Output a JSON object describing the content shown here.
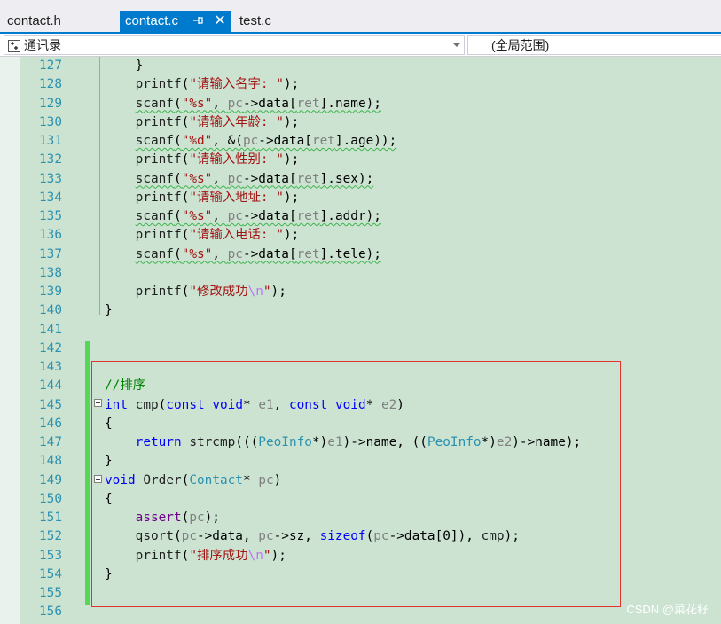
{
  "tabs": [
    {
      "label": "contact.h",
      "active": false
    },
    {
      "label": "contact.c",
      "active": true
    },
    {
      "label": "test.c",
      "active": false
    }
  ],
  "nav": {
    "scope_left": "通讯录",
    "scope_right": "(全局范围)"
  },
  "editor": {
    "lines": [
      {
        "n": "127",
        "tokens": [
          [
            "plain",
            "    }"
          ]
        ]
      },
      {
        "n": "128",
        "tokens": [
          [
            "plain",
            "    "
          ],
          [
            "fn",
            "printf"
          ],
          [
            "plain",
            "("
          ],
          [
            "str",
            "\"请输入名字: \""
          ],
          [
            "plain",
            ");"
          ]
        ]
      },
      {
        "n": "129",
        "squig": true,
        "tokens": [
          [
            "plain",
            "    "
          ],
          [
            "fn",
            "scanf"
          ],
          [
            "plain",
            "("
          ],
          [
            "str",
            "\"%s\""
          ],
          [
            "plain",
            ", "
          ],
          [
            "param",
            "pc"
          ],
          [
            "plain",
            "->data["
          ],
          [
            "param",
            "ret"
          ],
          [
            "plain",
            "].name);"
          ]
        ]
      },
      {
        "n": "130",
        "tokens": [
          [
            "plain",
            "    "
          ],
          [
            "fn",
            "printf"
          ],
          [
            "plain",
            "("
          ],
          [
            "str",
            "\"请输入年龄: \""
          ],
          [
            "plain",
            ");"
          ]
        ]
      },
      {
        "n": "131",
        "squig": true,
        "tokens": [
          [
            "plain",
            "    "
          ],
          [
            "fn",
            "scanf"
          ],
          [
            "plain",
            "("
          ],
          [
            "str",
            "\"%d\""
          ],
          [
            "plain",
            ", &("
          ],
          [
            "param",
            "pc"
          ],
          [
            "plain",
            "->data["
          ],
          [
            "param",
            "ret"
          ],
          [
            "plain",
            "].age));"
          ]
        ]
      },
      {
        "n": "132",
        "tokens": [
          [
            "plain",
            "    "
          ],
          [
            "fn",
            "printf"
          ],
          [
            "plain",
            "("
          ],
          [
            "str",
            "\"请输入性别: \""
          ],
          [
            "plain",
            ");"
          ]
        ]
      },
      {
        "n": "133",
        "squig": true,
        "tokens": [
          [
            "plain",
            "    "
          ],
          [
            "fn",
            "scanf"
          ],
          [
            "plain",
            "("
          ],
          [
            "str",
            "\"%s\""
          ],
          [
            "plain",
            ", "
          ],
          [
            "param",
            "pc"
          ],
          [
            "plain",
            "->data["
          ],
          [
            "param",
            "ret"
          ],
          [
            "plain",
            "].sex);"
          ]
        ]
      },
      {
        "n": "134",
        "tokens": [
          [
            "plain",
            "    "
          ],
          [
            "fn",
            "printf"
          ],
          [
            "plain",
            "("
          ],
          [
            "str",
            "\"请输入地址: \""
          ],
          [
            "plain",
            ");"
          ]
        ]
      },
      {
        "n": "135",
        "squig": true,
        "tokens": [
          [
            "plain",
            "    "
          ],
          [
            "fn",
            "scanf"
          ],
          [
            "plain",
            "("
          ],
          [
            "str",
            "\"%s\""
          ],
          [
            "plain",
            ", "
          ],
          [
            "param",
            "pc"
          ],
          [
            "plain",
            "->data["
          ],
          [
            "param",
            "ret"
          ],
          [
            "plain",
            "].addr);"
          ]
        ]
      },
      {
        "n": "136",
        "tokens": [
          [
            "plain",
            "    "
          ],
          [
            "fn",
            "printf"
          ],
          [
            "plain",
            "("
          ],
          [
            "str",
            "\"请输入电话: \""
          ],
          [
            "plain",
            ");"
          ]
        ]
      },
      {
        "n": "137",
        "squig": true,
        "tokens": [
          [
            "plain",
            "    "
          ],
          [
            "fn",
            "scanf"
          ],
          [
            "plain",
            "("
          ],
          [
            "str",
            "\"%s\""
          ],
          [
            "plain",
            ", "
          ],
          [
            "param",
            "pc"
          ],
          [
            "plain",
            "->data["
          ],
          [
            "param",
            "ret"
          ],
          [
            "plain",
            "].tele);"
          ]
        ]
      },
      {
        "n": "138",
        "tokens": []
      },
      {
        "n": "139",
        "tokens": [
          [
            "plain",
            "    "
          ],
          [
            "fn",
            "printf"
          ],
          [
            "plain",
            "("
          ],
          [
            "str",
            "\"修改成功"
          ],
          [
            "esc",
            "\\n"
          ],
          [
            "str",
            "\""
          ],
          [
            "plain",
            ");"
          ]
        ]
      },
      {
        "n": "140",
        "tokens": [
          [
            "plain",
            "}"
          ]
        ]
      },
      {
        "n": "141",
        "tokens": []
      },
      {
        "n": "142",
        "tokens": []
      },
      {
        "n": "143",
        "tokens": []
      },
      {
        "n": "144",
        "tokens": [
          [
            "cm",
            "//排序"
          ]
        ]
      },
      {
        "n": "145",
        "tokens": [
          [
            "kw",
            "int"
          ],
          [
            "plain",
            " "
          ],
          [
            "fn",
            "cmp"
          ],
          [
            "plain",
            "("
          ],
          [
            "kw",
            "const"
          ],
          [
            "plain",
            " "
          ],
          [
            "kw",
            "void"
          ],
          [
            "plain",
            "* "
          ],
          [
            "param",
            "e1"
          ],
          [
            "plain",
            ", "
          ],
          [
            "kw",
            "const"
          ],
          [
            "plain",
            " "
          ],
          [
            "kw",
            "void"
          ],
          [
            "plain",
            "* "
          ],
          [
            "param",
            "e2"
          ],
          [
            "plain",
            ")"
          ]
        ]
      },
      {
        "n": "146",
        "tokens": [
          [
            "plain",
            "{"
          ]
        ]
      },
      {
        "n": "147",
        "tokens": [
          [
            "plain",
            "    "
          ],
          [
            "kw",
            "return"
          ],
          [
            "plain",
            " "
          ],
          [
            "fn",
            "strcmp"
          ],
          [
            "plain",
            "((("
          ],
          [
            "type",
            "PeoInfo"
          ],
          [
            "plain",
            "*)"
          ],
          [
            "param",
            "e1"
          ],
          [
            "plain",
            ")->name, (("
          ],
          [
            "type",
            "PeoInfo"
          ],
          [
            "plain",
            "*)"
          ],
          [
            "param",
            "e2"
          ],
          [
            "plain",
            ")->name);"
          ]
        ]
      },
      {
        "n": "148",
        "tokens": [
          [
            "plain",
            "}"
          ]
        ]
      },
      {
        "n": "149",
        "tokens": [
          [
            "kw",
            "void"
          ],
          [
            "plain",
            " "
          ],
          [
            "fn",
            "Order"
          ],
          [
            "plain",
            "("
          ],
          [
            "type",
            "Contact"
          ],
          [
            "plain",
            "* "
          ],
          [
            "param",
            "pc"
          ],
          [
            "plain",
            ")"
          ]
        ]
      },
      {
        "n": "150",
        "tokens": [
          [
            "plain",
            "{"
          ]
        ]
      },
      {
        "n": "151",
        "tokens": [
          [
            "plain",
            "    "
          ],
          [
            "macro",
            "assert"
          ],
          [
            "plain",
            "("
          ],
          [
            "param",
            "pc"
          ],
          [
            "plain",
            ");"
          ]
        ]
      },
      {
        "n": "152",
        "tokens": [
          [
            "plain",
            "    "
          ],
          [
            "fn",
            "qsort"
          ],
          [
            "plain",
            "("
          ],
          [
            "param",
            "pc"
          ],
          [
            "plain",
            "->data, "
          ],
          [
            "param",
            "pc"
          ],
          [
            "plain",
            "->sz, "
          ],
          [
            "kw",
            "sizeof"
          ],
          [
            "plain",
            "("
          ],
          [
            "param",
            "pc"
          ],
          [
            "plain",
            "->data[0]), "
          ],
          [
            "fn",
            "cmp"
          ],
          [
            "plain",
            ");"
          ]
        ]
      },
      {
        "n": "153",
        "tokens": [
          [
            "plain",
            "    "
          ],
          [
            "fn",
            "printf"
          ],
          [
            "plain",
            "("
          ],
          [
            "str",
            "\"排序成功"
          ],
          [
            "esc",
            "\\n"
          ],
          [
            "str",
            "\""
          ],
          [
            "plain",
            ");"
          ]
        ]
      },
      {
        "n": "154",
        "tokens": [
          [
            "plain",
            "}"
          ]
        ]
      },
      {
        "n": "155",
        "tokens": []
      },
      {
        "n": "156",
        "tokens": []
      }
    ]
  },
  "watermark": "CSDN @菜花籽",
  "colors": {
    "editor_bg": "#cce3d2",
    "accent": "#007acc",
    "line_number": "#2b91af",
    "keyword": "#0000ff",
    "string": "#a31515",
    "type": "#2b91af",
    "comment": "#008000",
    "highlight_box": "#e0342e",
    "change_bar": "#57d657"
  },
  "icons": [
    "pin-icon",
    "close-icon",
    "class-view-icon",
    "dropdown-arrow-icon",
    "collapse-icon"
  ]
}
